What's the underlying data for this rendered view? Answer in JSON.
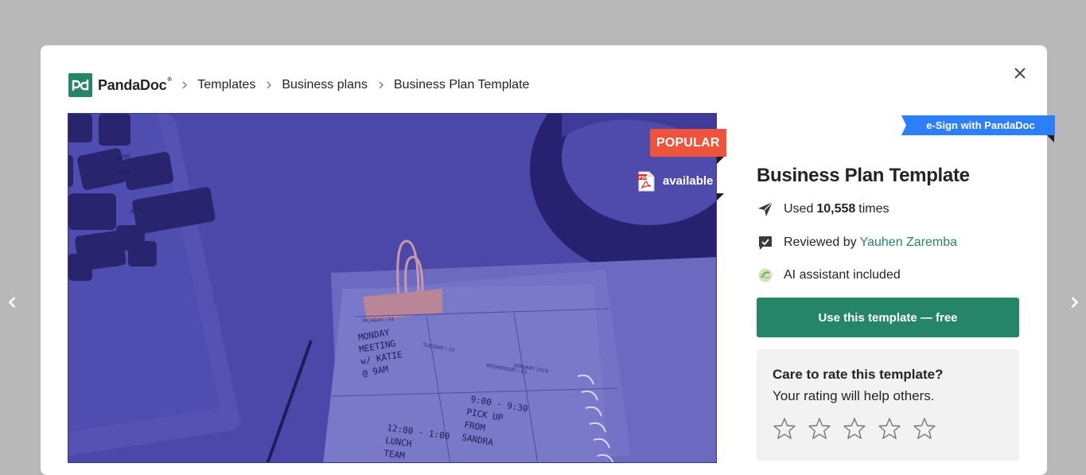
{
  "breadcrumb": {
    "logo_text": "PandaDoc",
    "logo_mark": "®",
    "items": [
      "Templates",
      "Business plans",
      "Business Plan Template"
    ]
  },
  "preview": {
    "popular_label": "POPULAR",
    "pdf_label": "available",
    "image_description_icon": "document-preview-image",
    "handwriting": [
      "MONDAY",
      "MEETING",
      "w/ KATIE",
      "@ 9AM",
      "9:00 - 9:30",
      "PICK UP",
      "FROM",
      "SANDRA",
      "12:00 - 1:00",
      "LUNCH",
      "TEAM",
      "MONDAY / 01",
      "TUESDAY / 02",
      "WEDNESDAY / 03",
      "JANUARY 2018"
    ],
    "keyboard_keys": [
      "enter",
      "return",
      "shift"
    ]
  },
  "esign_label": "e-Sign with PandaDoc",
  "template": {
    "title": "Business Plan Template",
    "used_prefix": "Used",
    "used_count": "10,558",
    "used_suffix": "times",
    "reviewed_prefix": "Reviewed by",
    "reviewer": "Yauhen Zaremba",
    "ai_text": "AI assistant included",
    "cta_label": "Use this template — free"
  },
  "rating": {
    "title": "Care to rate this template?",
    "subtitle": "Your rating will help others.",
    "max_stars": 5,
    "current": 0
  },
  "colors": {
    "brand_green": "#248567",
    "popular_red": "#f0533b",
    "esign_blue": "#2d7ff9",
    "preview_overlay": "#4a47a8"
  },
  "icons": {
    "prev": "chevron-left-icon",
    "next": "chevron-right-icon",
    "close": "close-icon",
    "used": "send-icon",
    "reviewed": "checked-comment-icon",
    "ai": "ai-sparkle-icon",
    "pdf": "pdf-file-icon",
    "star": "star-outline-icon"
  }
}
